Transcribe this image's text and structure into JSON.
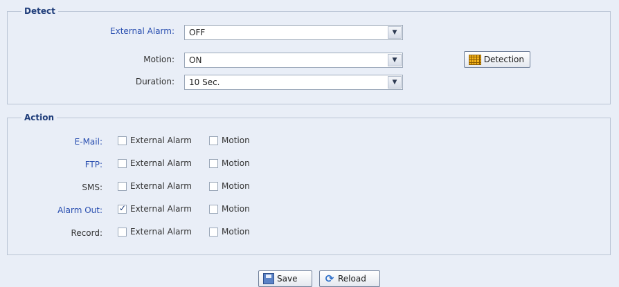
{
  "detect": {
    "legend": "Detect",
    "external_alarm": {
      "label": "External Alarm:",
      "value": "OFF"
    },
    "motion": {
      "label": "Motion:",
      "value": "ON"
    },
    "duration": {
      "label": "Duration:",
      "value": "10 Sec."
    },
    "detection_button": "Detection"
  },
  "action": {
    "legend": "Action",
    "rows": [
      {
        "label": "E-Mail:",
        "external_alarm": "External Alarm",
        "external_alarm_checked": false,
        "motion": "Motion",
        "motion_checked": false
      },
      {
        "label": "FTP:",
        "external_alarm": "External Alarm",
        "external_alarm_checked": false,
        "motion": "Motion",
        "motion_checked": false
      },
      {
        "label": "SMS:",
        "external_alarm": "External Alarm",
        "external_alarm_checked": false,
        "motion": "Motion",
        "motion_checked": false
      },
      {
        "label": "Alarm Out:",
        "external_alarm": "External Alarm",
        "external_alarm_checked": true,
        "motion": "Motion",
        "motion_checked": false
      },
      {
        "label": "Record:",
        "external_alarm": "External Alarm",
        "external_alarm_checked": false,
        "motion": "Motion",
        "motion_checked": false
      }
    ]
  },
  "footer": {
    "save": "Save",
    "reload": "Reload"
  },
  "icons": {
    "dropdown": "chevron-down-icon",
    "detection": "grid-icon",
    "save": "save-icon",
    "reload": "reload-icon"
  },
  "colors": {
    "legend": "#1f3d7a",
    "link_label": "#2a4fb0",
    "background": "#e9eef7"
  }
}
